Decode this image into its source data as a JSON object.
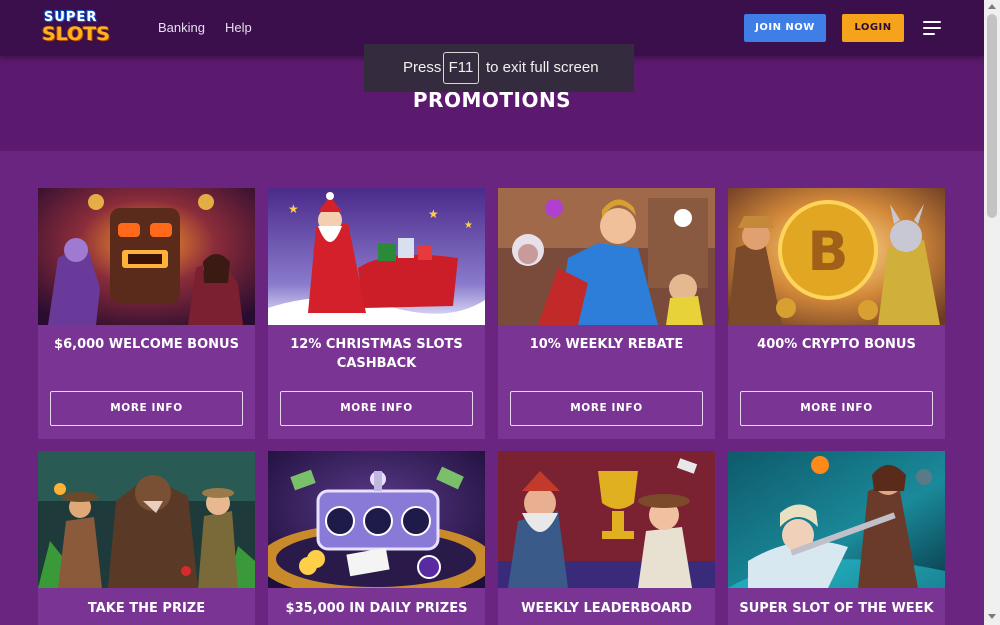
{
  "header": {
    "logo_top": "SUPER",
    "logo_bottom": "SLOTS",
    "nav": [
      "Banking",
      "Help"
    ],
    "join_label": "JOIN NOW",
    "login_label": "LOGIN"
  },
  "toast": {
    "before": "Press",
    "key": "F11",
    "after": "to exit full screen"
  },
  "page_title": "PROMOTIONS",
  "promotions": [
    {
      "title": "$6,000 WELCOME BONUS",
      "button": "MORE INFO"
    },
    {
      "title": "12% CHRISTMAS SLOTS CASHBACK",
      "button": "MORE INFO"
    },
    {
      "title": "10% WEEKLY REBATE",
      "button": "MORE INFO"
    },
    {
      "title": "400% CRYPTO BONUS",
      "button": "MORE INFO"
    },
    {
      "title": "TAKE THE PRIZE"
    },
    {
      "title": "$35,000 IN DAILY PRIZES"
    },
    {
      "title": "WEEKLY LEADERBOARD"
    },
    {
      "title": "SUPER SLOT OF THE WEEK"
    }
  ],
  "colors": {
    "header_bg": "#3b0f4c",
    "page_bg": "#6a2580",
    "card_bg": "#7a3494",
    "join_button": "#3f7ee6",
    "login_button": "#f4a31a"
  }
}
